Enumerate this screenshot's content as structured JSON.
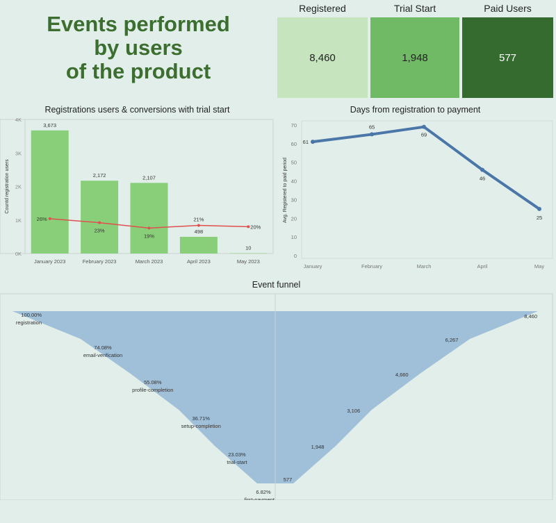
{
  "title_lines": [
    "Events performed",
    "by users",
    "of the product"
  ],
  "kpis": [
    {
      "label": "Registered",
      "value": "8,460",
      "bg": "#c6e5bf",
      "fg": "#222222"
    },
    {
      "label": "Trial Start",
      "value": "1,948",
      "bg": "#70b965",
      "fg": "#222222"
    },
    {
      "label": "Paid Users",
      "value": "577",
      "bg": "#366b2f",
      "fg": "#ffffff"
    }
  ],
  "chart_titles": {
    "registrations": "Registrations users & conversions with trial start",
    "days": "Days from registration to payment",
    "funnel": "Event funnel"
  },
  "chart_data": [
    {
      "type": "bar",
      "title": "Registrations users & conversions with trial start",
      "ylabel": "Countd registration users",
      "categories": [
        "January 2023",
        "February 2023",
        "March 2023",
        "April 2023",
        "May 2023"
      ],
      "values": [
        3673,
        2172,
        2107,
        498,
        10
      ],
      "value_labels": [
        "3,673",
        "2,172",
        "2,107",
        "498",
        "10"
      ],
      "line_series": {
        "values": [
          26,
          23,
          19,
          21,
          20
        ],
        "labels": [
          "26%",
          "23%",
          "19%",
          "21%",
          "20%"
        ],
        "color": "#e05050"
      },
      "ylim": [
        0,
        4000
      ],
      "yticks": [
        0,
        1000,
        2000,
        3000,
        4000
      ],
      "ytick_labels": [
        "0K",
        "1K",
        "2K",
        "3K",
        "4K"
      ],
      "bar_color": "#89cf79"
    },
    {
      "type": "line",
      "title": "Days from registration to payment",
      "ylabel": "Avg. Registered to paid period",
      "categories": [
        "January",
        "February",
        "March",
        "April",
        "May"
      ],
      "values": [
        61,
        65,
        69,
        46,
        25
      ],
      "ylim": [
        0,
        70
      ],
      "yticks": [
        0,
        10,
        20,
        30,
        40,
        50,
        60,
        70
      ],
      "line_color": "#4a76a8"
    },
    {
      "type": "area",
      "title": "Event funnel",
      "stages": [
        "registration",
        "email-verification",
        "profile-completion",
        "setup-completion",
        "trial-start",
        "first-payment"
      ],
      "percentages": [
        "100.00%",
        "74.08%",
        "55.08%",
        "36.71%",
        "23.03%",
        "6.82%"
      ],
      "counts": [
        8460,
        6267,
        4660,
        3106,
        1948,
        577
      ],
      "count_labels": [
        "8,460",
        "6,267",
        "4,660",
        "3,106",
        "1,948",
        "577"
      ],
      "fill_color": "#a0bfd8"
    }
  ]
}
